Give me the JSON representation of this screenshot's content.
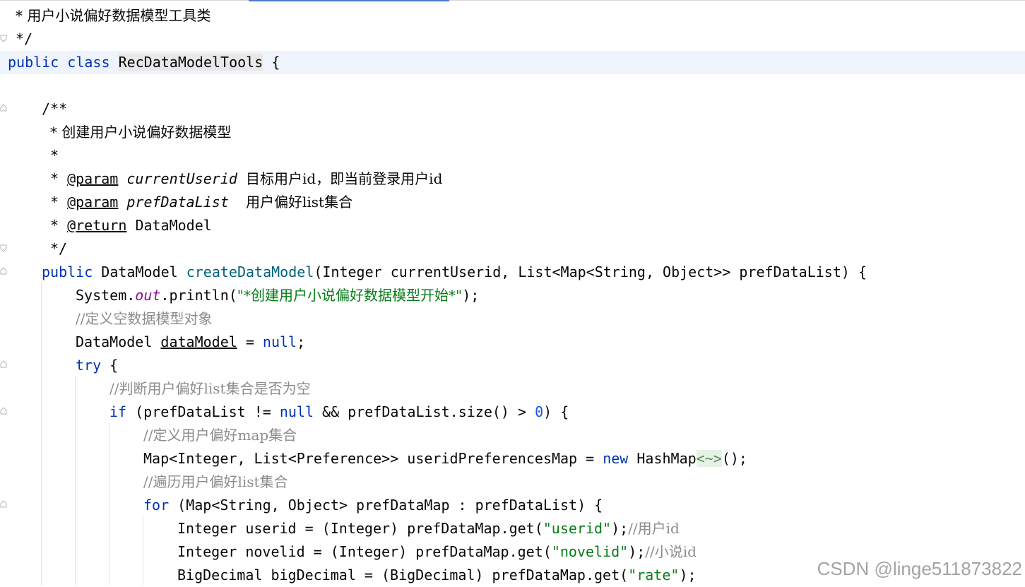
{
  "code": {
    "l01": "* 用户小说偏好数据模型工具类",
    "l02": "*/",
    "l03_kw1": "public",
    "l03_kw2": "class",
    "l03_name": "RecDataModelTools",
    "l03_brace": "{",
    "l05": "/**",
    "l06": "* 创建用户小说偏好数据模型",
    "l07": "*",
    "l08_star": "*",
    "l08_tag": "@param",
    "l08_param": "currentUserid",
    "l08_desc": "目标用户id，即当前登录用户id",
    "l09_star": "*",
    "l09_tag": "@param",
    "l09_param": "prefDataList",
    "l09_desc": "用户偏好list集合",
    "l10_star": "*",
    "l10_tag": "@return",
    "l10_desc": "DataModel",
    "l11": "*/",
    "l12_kw": "public",
    "l12_type": "DataModel",
    "l12_fn": "createDataModel",
    "l12_rest": "(Integer currentUserid, List<Map<String, Object>> prefDataList) {",
    "l13_a": "System.",
    "l13_field": "out",
    "l13_b": ".println(",
    "l13_str": "\"*创建用户小说偏好数据模型开始*\"",
    "l13_c": ");",
    "l14": "//定义空数据模型对象",
    "l15_a": "DataModel ",
    "l15_var": "dataModel",
    "l15_b": " = ",
    "l15_kw": "null",
    "l15_c": ";",
    "l16_kw": "try",
    "l16_b": " {",
    "l17": "//判断用户偏好list集合是否为空",
    "l18_kw": "if",
    "l18_a": " (prefDataList != ",
    "l18_kw2": "null",
    "l18_b": " && prefDataList.size() > ",
    "l18_num": "0",
    "l18_c": ") {",
    "l19": "//定义用户偏好map集合",
    "l20_a": "Map<Integer, List<Preference>> useridPreferencesMap = ",
    "l20_kw": "new",
    "l20_b": " HashMap",
    "l20_diamond": "<~>",
    "l20_c": "();",
    "l21": "//遍历用户偏好list集合",
    "l22_kw": "for",
    "l22_a": " (Map<String, Object> prefDataMap : prefDataList) {",
    "l23_a": "Integer userid = (Integer) prefDataMap.get(",
    "l23_str": "\"userid\"",
    "l23_b": ");",
    "l23_cm": "//用户id",
    "l24_a": "Integer novelid = (Integer) prefDataMap.get(",
    "l24_str": "\"novelid\"",
    "l24_b": ");",
    "l24_cm": "//小说id",
    "l25_a": "BigDecimal bigDecimal = (BigDecimal) prefDataMap.get(",
    "l25_str": "\"rate\"",
    "l25_b": ");"
  },
  "watermark": "CSDN @linge511873822",
  "colors": {
    "keyword": "#0033b3",
    "method": "#00627a",
    "string": "#067d17",
    "number": "#1750eb",
    "static_field": "#871094",
    "comment": "#8c8c8c",
    "current_line": "#eef3fc"
  }
}
